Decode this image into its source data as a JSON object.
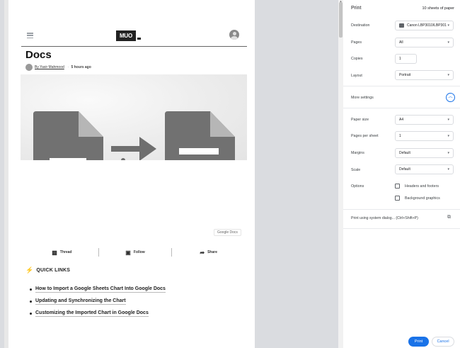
{
  "preview": {
    "logo_text": "MUO",
    "article_title": "Docs",
    "byline_author": "By Yasir Mahmood",
    "byline_time": "5 hours ago",
    "image_caption": "Google Docs",
    "social": [
      {
        "label": "Thread",
        "icon": "thread-icon"
      },
      {
        "label": "Follow",
        "icon": "follow-icon"
      },
      {
        "label": "Share",
        "icon": "share-icon"
      }
    ],
    "quick_links_heading": "QUICK LINKS",
    "quick_links": [
      "How to Import a Google Sheets Chart Into Google Docs",
      "Updating and Synchronizing the Chart",
      "Customizing the Imported Chart in Google Docs"
    ],
    "hero_colors": {
      "doc": "#717171",
      "fold": "#b6b6b6",
      "arrow": "#6e6e6e"
    }
  },
  "panel": {
    "title": "Print",
    "sheets": "10 sheets of paper",
    "destination_label": "Destination",
    "destination_value": "Canon LBP3010/LBP301",
    "pages_label": "Pages",
    "pages_value": "All",
    "copies_label": "Copies",
    "copies_value": "1",
    "layout_label": "Layout",
    "layout_value": "Portrait",
    "more_settings_label": "More settings",
    "paper_size_label": "Paper size",
    "paper_size_value": "A4",
    "pages_per_sheet_label": "Pages per sheet",
    "pages_per_sheet_value": "1",
    "margins_label": "Margins",
    "margins_value": "Default",
    "scale_label": "Scale",
    "scale_value": "Default",
    "options_label": "Options",
    "option_headers": "Headers and footers",
    "option_background": "Background graphics",
    "system_dialog": "Print using system dialog... (Ctrl+Shift+P)",
    "print_button": "Print",
    "cancel_button": "Cancel",
    "accent_color": "#1a73e8"
  }
}
